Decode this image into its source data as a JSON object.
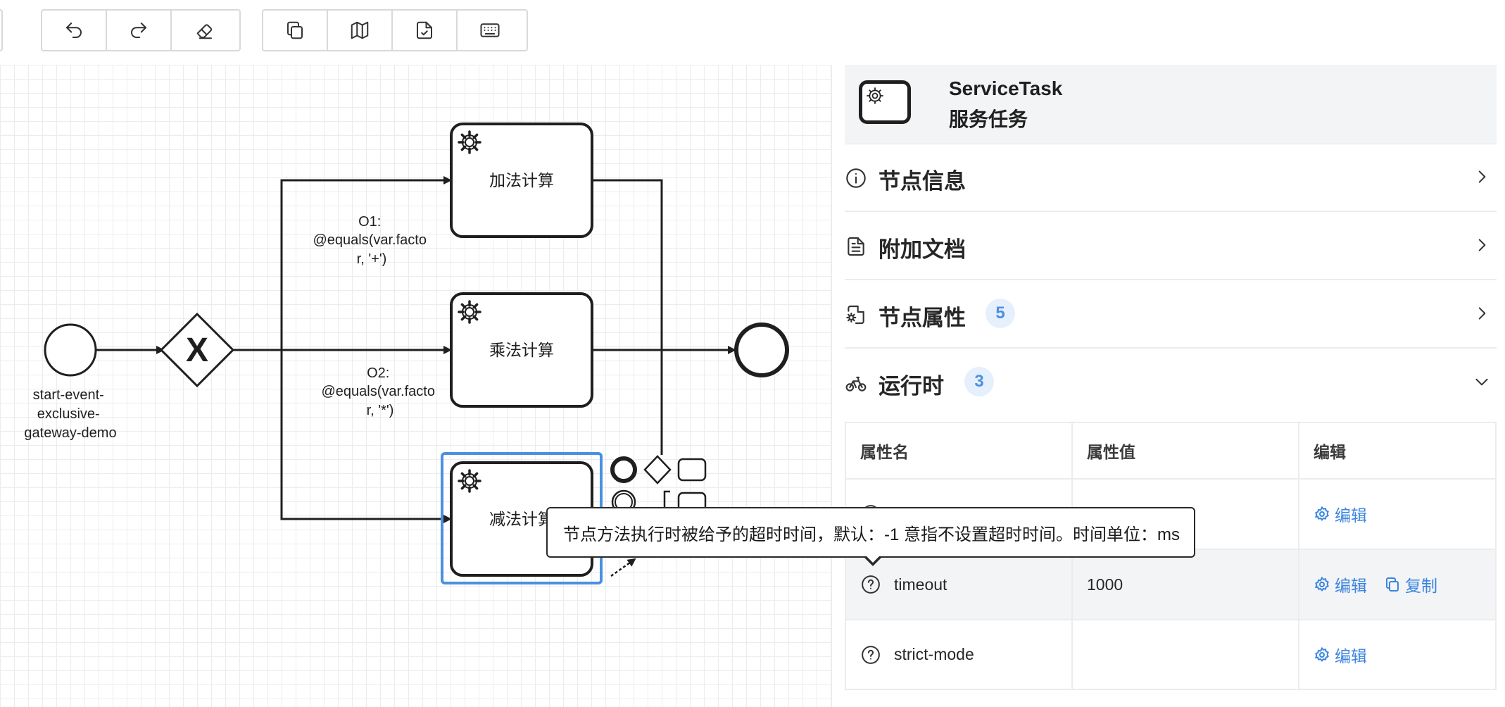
{
  "toolbar": {
    "group1": [
      {
        "name": "undo",
        "icon": "undo-icon"
      },
      {
        "name": "redo",
        "icon": "redo-icon"
      },
      {
        "name": "erase",
        "icon": "eraser-icon"
      }
    ],
    "group2": [
      {
        "name": "copy",
        "icon": "copy-icon"
      },
      {
        "name": "map",
        "icon": "map-icon"
      },
      {
        "name": "validate",
        "icon": "file-check-icon"
      },
      {
        "name": "keyboard",
        "icon": "keyboard-icon"
      }
    ]
  },
  "diagram": {
    "start_event_label_lines": [
      "start-event-",
      "exclusive-",
      "gateway-demo"
    ],
    "gateway_symbol": "X",
    "tasks": {
      "add": "加法计算",
      "multiply": "乘法计算",
      "subtract": "减法计算"
    },
    "flow1_label_lines": [
      "O1:",
      "@equals(var.facto",
      "r, '+')"
    ],
    "flow2_label_lines": [
      "O2:",
      "@equals(var.facto",
      "r, '*')"
    ]
  },
  "panel": {
    "title": "ServiceTask",
    "subtitle": "服务任务",
    "sections": {
      "node_info": {
        "label": "节点信息",
        "icon": "info-icon"
      },
      "attached_docs": {
        "label": "附加文档",
        "icon": "document-icon"
      },
      "node_props": {
        "label": "节点属性",
        "badge": "5",
        "icon": "settings-file-icon"
      },
      "runtime": {
        "label": "运行时",
        "badge": "3",
        "icon": "bike-icon"
      }
    },
    "table": {
      "headers": {
        "name": "属性名",
        "value": "属性值",
        "edit": "编辑"
      },
      "rows": [
        {
          "name": "",
          "value": "",
          "edit": "编辑"
        },
        {
          "name": "timeout",
          "value": "1000",
          "edit": "编辑",
          "copy": "复制"
        },
        {
          "name": "strict-mode",
          "value": "",
          "edit": "编辑"
        }
      ]
    }
  },
  "tooltip": {
    "text": "节点方法执行时被给予的超时时间，默认：-1 意指不设置超时时间。时间单位：ms"
  },
  "colors": {
    "accent": "#3a84e0",
    "selection": "#4a90e2",
    "badge_bg": "#e6f0fc"
  }
}
